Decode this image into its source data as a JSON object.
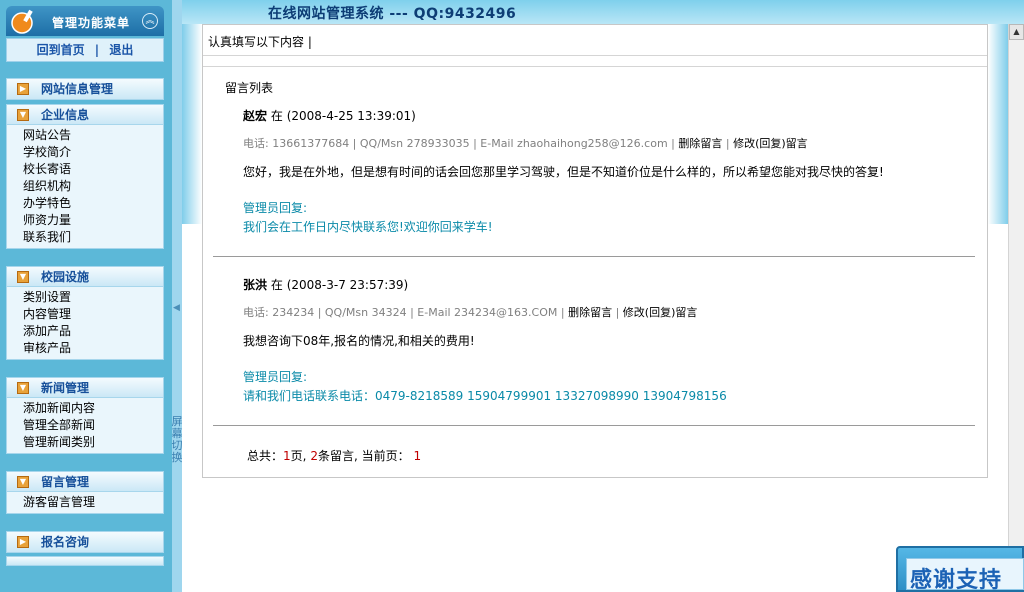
{
  "sidebar": {
    "title": "管理功能菜单",
    "links": {
      "home": "回到首页",
      "logout": "退出",
      "separator": "|"
    },
    "site_info": "网站信息管理",
    "groups": [
      {
        "title": "企业信息",
        "items": [
          "网站公告",
          "学校简介",
          "校长寄语",
          "组织机构",
          "办学特色",
          "师资力量",
          "联系我们"
        ]
      },
      {
        "title": "校园设施",
        "items": [
          "类别设置",
          "内容管理",
          "添加产品",
          "审核产品"
        ]
      },
      {
        "title": "新闻管理",
        "items": [
          "添加新闻内容",
          "管理全部新闻",
          "管理新闻类别"
        ]
      },
      {
        "title": "留言管理",
        "items": [
          "游客留言管理"
        ]
      }
    ],
    "last_group": "报名咨询"
  },
  "splitter": {
    "label": "屏幕切换"
  },
  "topbar": {
    "title": "在线网站管理系统 --- QQ:9432496"
  },
  "panel": {
    "notice": "认真填写以下内容 |",
    "list_title": "留言列表",
    "entries": [
      {
        "name": "赵宏",
        "at": "在",
        "time": "(2008-4-25 13:39:01)",
        "contact": "电话: 13661377684 | QQ/Msn 278933035 | E-Mail zhaohaihong258@126.com |",
        "delete_label": "删除留言",
        "edit_label": "修改(回复)留言",
        "sep": "|",
        "message": "您好，我是在外地，但是想有时间的话会回您那里学习驾驶，但是不知道价位是什么样的，所以希望您能对我尽快的答复!",
        "reply_label": "管理员回复:",
        "reply": "我们会在工作日内尽快联系您!欢迎你回来学车!"
      },
      {
        "name": "张洪",
        "at": "在",
        "time": "(2008-3-7 23:57:39)",
        "contact": "电话: 234234 | QQ/Msn 34324 | E-Mail 234234@163.COM |",
        "delete_label": "删除留言",
        "edit_label": "修改(回复)留言",
        "sep": "|",
        "message": "我想咨询下08年,报名的情况,和相关的费用!",
        "reply_label": "管理员回复:",
        "reply": "请和我们电话联系电话：0479-8218589 15904799901 13327098990 13904798156"
      }
    ],
    "pager": {
      "prefix": "总共：",
      "pages": "1",
      "pages_suffix": "页,",
      "count": "2",
      "count_suffix": "条留言,",
      "current_prefix": "当前页：",
      "current": "1"
    }
  },
  "badge": {
    "text": "感谢支持"
  },
  "colors": {
    "sidebar_bg": "#5cb8d8",
    "reply": "#0a8aa8",
    "link": "#1a55a8",
    "pager_num": "#c00000"
  },
  "icons": {
    "logo": "brush-icon",
    "collapse": "double-chevron-up-icon",
    "group": "arrow-right-icon",
    "splitter": "triangle-left-icon",
    "scroll_up": "triangle-up-icon"
  }
}
